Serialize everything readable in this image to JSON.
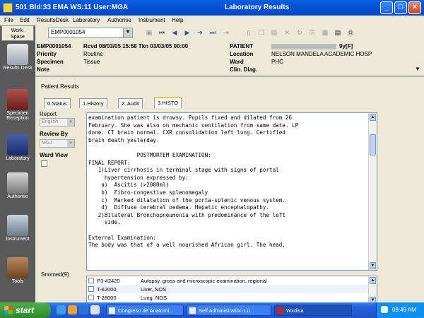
{
  "window": {
    "title_left": "501 Bld:33 EMA WS:11 User:MGA",
    "title_center": "Laboratory Results"
  },
  "menu": [
    "File",
    "Edit",
    "ResultsDesk",
    "Laboratory",
    "Authorise",
    "Instrument",
    "Help"
  ],
  "nav": {
    "workspace": "Work-\nSpace",
    "items": [
      "Results Desk",
      "Specimen Reception",
      "Laboratory",
      "Authorise",
      "Instrument",
      "Tools"
    ]
  },
  "toolbar": {
    "specimen_select": "EMP0001054"
  },
  "header": {
    "specimen_id": "EMP0001054",
    "received": "Rcvd 08/03/05 15:58 Tkn 03/03/05 00:00",
    "priority_label": "Priority",
    "priority_value": "Routine",
    "specimen_label": "Specimen",
    "specimen_value": "Tissue",
    "note_label": "Note",
    "patient_label": "PATIENT",
    "patient_age": "9y[F]",
    "location_label": "Location",
    "location_value": "NELSON MANDELA ACADEMIC HOSP",
    "ward_label": "Ward",
    "ward_value": "PHC",
    "clin_label": "Clin. Diag."
  },
  "panel": {
    "title": "Patient Results",
    "tabs": [
      "0.Status",
      "1.History",
      "2. Audit",
      "3.HISTO"
    ],
    "report_label": "Report",
    "report_value": "English",
    "review_label": "Review By",
    "review_value": "MGJ",
    "ward_view_label": "Ward View",
    "snomed_label": "Snomed(9)"
  },
  "report_text": "examination patient is drowsy. Pupils fixed and dilated from 26\nFebruary. She was also on mechanic ventilation from same date. LP\ndone. CT brain normal. CXR consolidation left lung. Certified\nbrain death yesterday.\n\n               POSTMORTEM EXAMINATION:\nFINAL REPORT:\n   1)Liver cirrhosis in terminal stage with signs of portal\n     hypertension expressed by:\n    a)  Ascitis (>2000ml)\n    b)  Fibro-congestive splenomegaly\n    c)  Marked dilatation of the porta-splenic venous system.\n    d)  Diffuse cerebral oedema. Hepatic encephalopathy.\n   2)Bilateral Bronchopneumonia with predominance of the left\n     side.\n\nExternal Examination:\nThe body was that of a well nourished African girl. The head,",
  "snomed": [
    {
      "code": "P3-42420",
      "desc": "Autopsy, gross and microscopic examination, regional"
    },
    {
      "code": "T-62000",
      "desc": "Liver, NOS"
    },
    {
      "code": "T-28000",
      "desc": "Lung, NOS"
    }
  ],
  "taskbar": {
    "start": "start",
    "tasks": [
      "Congreso de Anatomi...",
      "Self Administration Lo...",
      "Wxdisa"
    ],
    "clock": "09:49 AM"
  }
}
